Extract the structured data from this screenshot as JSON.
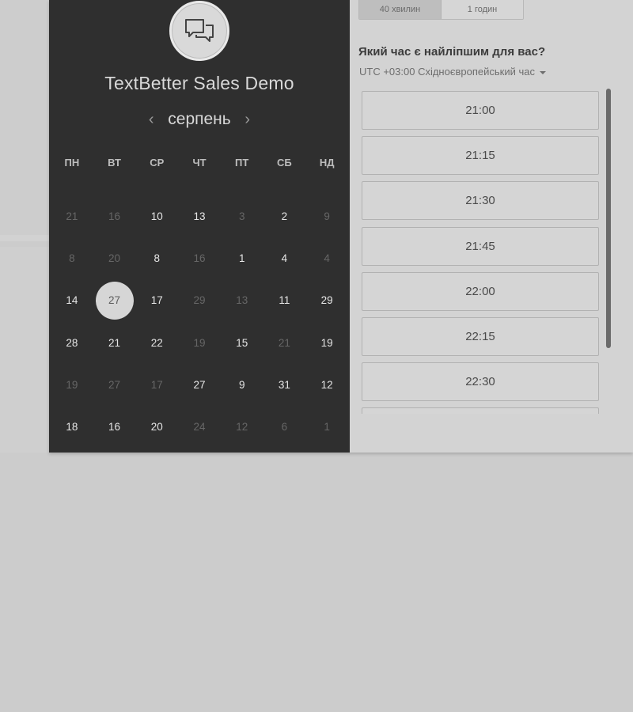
{
  "event": {
    "title": "TextBetter Sales Demo"
  },
  "calendar": {
    "month": "серпень",
    "prev_icon": "chevron-left-icon",
    "next_icon": "chevron-right-icon",
    "weekdays": [
      "ПН",
      "ВТ",
      "СР",
      "ЧТ",
      "ПТ",
      "СБ",
      "НД"
    ],
    "days": [
      {
        "label": "21",
        "available": false
      },
      {
        "label": "16",
        "available": false
      },
      {
        "label": "10",
        "available": true
      },
      {
        "label": "13",
        "available": true
      },
      {
        "label": "3",
        "available": false
      },
      {
        "label": "2",
        "available": true
      },
      {
        "label": "9",
        "available": false
      },
      {
        "label": "8",
        "available": false
      },
      {
        "label": "20",
        "available": false
      },
      {
        "label": "8",
        "available": true
      },
      {
        "label": "16",
        "available": false
      },
      {
        "label": "1",
        "available": true
      },
      {
        "label": "4",
        "available": true
      },
      {
        "label": "4",
        "available": false
      },
      {
        "label": "14",
        "available": true
      },
      {
        "label": "27",
        "available": true,
        "selected": true
      },
      {
        "label": "17",
        "available": true
      },
      {
        "label": "29",
        "available": false
      },
      {
        "label": "13",
        "available": false
      },
      {
        "label": "11",
        "available": true
      },
      {
        "label": "29",
        "available": true
      },
      {
        "label": "28",
        "available": true
      },
      {
        "label": "21",
        "available": true
      },
      {
        "label": "22",
        "available": true
      },
      {
        "label": "19",
        "available": false
      },
      {
        "label": "15",
        "available": true
      },
      {
        "label": "21",
        "available": false
      },
      {
        "label": "19",
        "available": true
      },
      {
        "label": "19",
        "available": false
      },
      {
        "label": "27",
        "available": false
      },
      {
        "label": "17",
        "available": false
      },
      {
        "label": "27",
        "available": true
      },
      {
        "label": "9",
        "available": true
      },
      {
        "label": "31",
        "available": true
      },
      {
        "label": "12",
        "available": true
      },
      {
        "label": "18",
        "available": true
      },
      {
        "label": "16",
        "available": true
      },
      {
        "label": "20",
        "available": true
      },
      {
        "label": "24",
        "available": false
      },
      {
        "label": "12",
        "available": false
      },
      {
        "label": "6",
        "available": false
      },
      {
        "label": "1",
        "available": false
      }
    ]
  },
  "duration": {
    "options": [
      {
        "label": "40 хвилин",
        "active": true
      },
      {
        "label": "1 годин",
        "active": false
      }
    ]
  },
  "booking": {
    "question": "Який час є найліпшим для вас?",
    "timezone": "UTC +03:00 Східноєвропейський час"
  },
  "slots": [
    "21:00",
    "21:15",
    "21:30",
    "21:45",
    "22:00",
    "22:15",
    "22:30",
    ""
  ]
}
